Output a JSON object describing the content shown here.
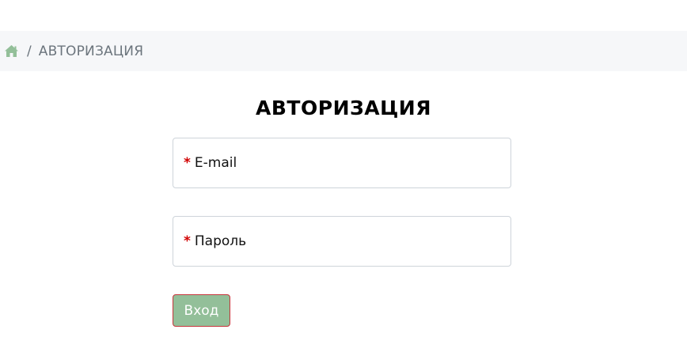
{
  "breadcrumb": {
    "home_icon": "home-icon",
    "separator": "/",
    "current": "АВТОРИЗАЦИЯ"
  },
  "page": {
    "title": "АВТОРИЗАЦИЯ"
  },
  "form": {
    "required_marker": "*",
    "email_label": "E-mail",
    "password_label": "Пароль",
    "submit_label": "Вход"
  },
  "colors": {
    "accent_green": "#93bf99",
    "required_red": "#d10000",
    "breadcrumb_bg": "#f6f7f9",
    "muted_text": "#6c757d"
  }
}
